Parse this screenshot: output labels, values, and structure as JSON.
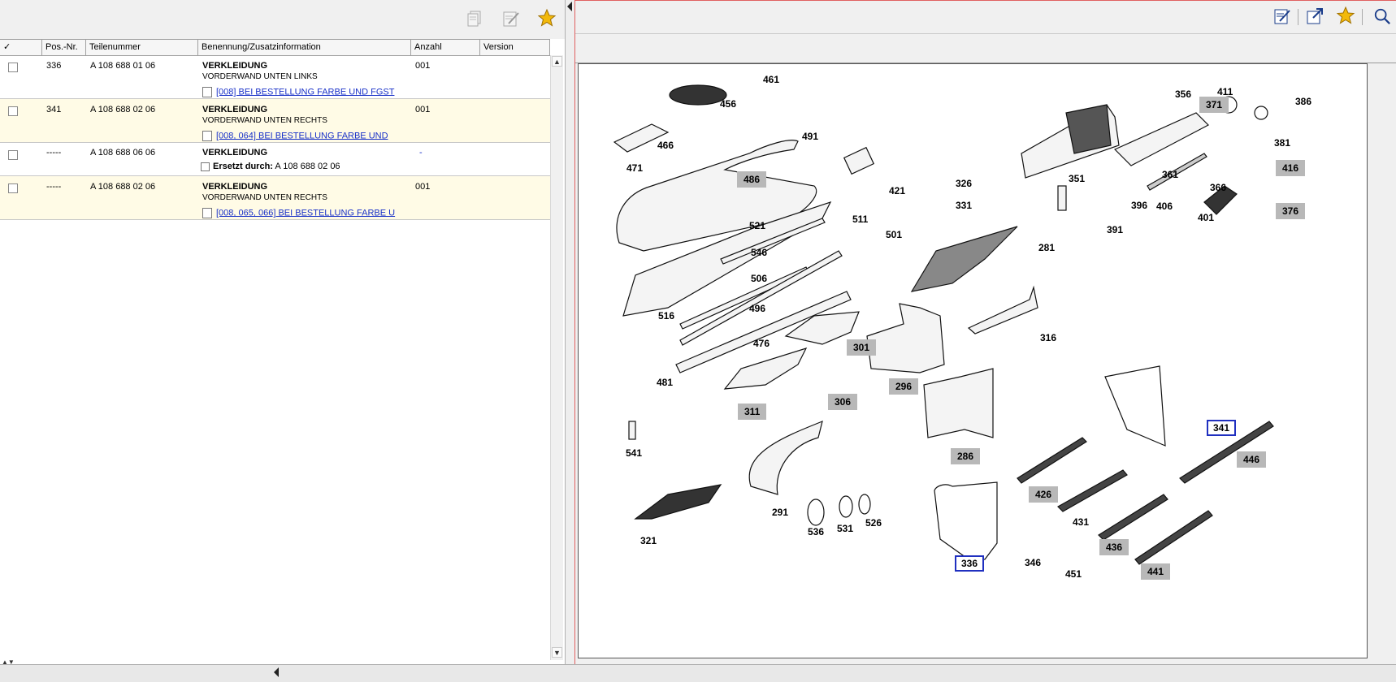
{
  "left_toolbar": {
    "icons": [
      "copy-icon",
      "edit-note-icon",
      "star-icon"
    ],
    "accent_star": "#f2b90a"
  },
  "table": {
    "headers": {
      "check": "✓",
      "pos": "Pos.-Nr.",
      "part": "Teilenummer",
      "desc": "Benennung/Zusatzinformation",
      "qty": "Anzahl",
      "version": "Version"
    },
    "rows": [
      {
        "pos": "336",
        "part": "A 108 688 01 06",
        "name": "VERKLEIDUNG",
        "info": "VORDERWAND UNTEN LINKS",
        "note": "[008] BEI BESTELLUNG FARBE UND FGST",
        "qty": "001"
      },
      {
        "pos": "341",
        "part": "A 108 688 02 06",
        "name": "VERKLEIDUNG",
        "info": "VORDERWAND UNTEN RECHTS",
        "note": "[008, 064] BEI BESTELLUNG FARBE UND",
        "qty": "001"
      },
      {
        "pos": "-----",
        "part": "A 108 688 06 06",
        "name": "VERKLEIDUNG",
        "replaced_label": "Ersetzt durch:",
        "replaced_value": "A 108 688 02 06",
        "qty": "-"
      },
      {
        "pos": "-----",
        "part": "A 108 688 02 06",
        "name": "VERKLEIDUNG",
        "info": "VORDERWAND UNTEN RECHTS",
        "note": "[008, 065, 066] BEI BESTELLUNG FARBE U",
        "qty": "001"
      }
    ]
  },
  "right_toolbar": {
    "icons": [
      "edit-note-icon",
      "expand-window-icon",
      "star-icon",
      "search-icon"
    ]
  },
  "drawing": {
    "labels": [
      "461",
      "456",
      "466",
      "491",
      "471",
      "486",
      "521",
      "546",
      "506",
      "496",
      "516",
      "476",
      "481",
      "511",
      "501",
      "421",
      "326",
      "331",
      "281",
      "356",
      "371",
      "411",
      "386",
      "381",
      "351",
      "361",
      "366",
      "416",
      "376",
      "396",
      "406",
      "401",
      "391",
      "301",
      "306",
      "311",
      "296",
      "316",
      "286",
      "341",
      "541",
      "291",
      "321",
      "536",
      "531",
      "526",
      "336",
      "346",
      "426",
      "431",
      "436",
      "441",
      "446",
      "451"
    ],
    "highlighted": [
      "486",
      "301",
      "306",
      "311",
      "296",
      "286",
      "371",
      "416",
      "376",
      "426",
      "436",
      "441",
      "446"
    ],
    "selected": [
      "341",
      "336"
    ],
    "colors": {
      "highlight": "#b8b8b8",
      "selection": "#2030c0",
      "frame": "#e06060"
    }
  }
}
